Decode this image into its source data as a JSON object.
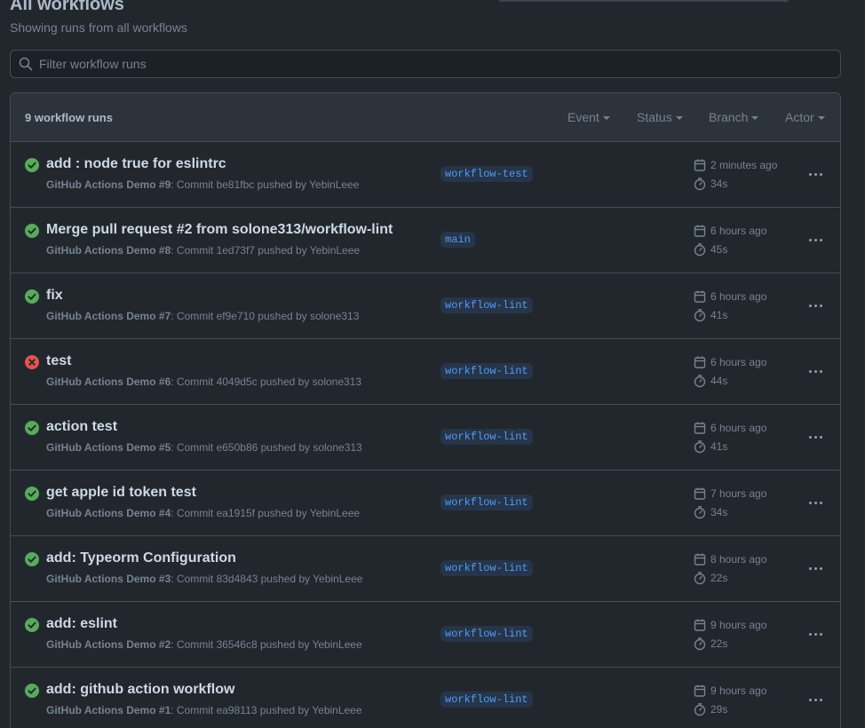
{
  "header": {
    "title": "All workflows",
    "subtitle": "Showing runs from all workflows"
  },
  "search": {
    "placeholder": "Filter workflow runs",
    "value": ""
  },
  "runs_header": {
    "count_label": "9 workflow runs",
    "filters": [
      "Event",
      "Status",
      "Branch",
      "Actor"
    ]
  },
  "colors": {
    "success": "#57ab5a",
    "failure": "#e5534b",
    "branch_text": "#539bf5"
  },
  "runs": [
    {
      "status": "success",
      "title": "add : node true for eslintrc",
      "workflow": "GitHub Actions Demo #9",
      "detail": ": Commit be81fbc pushed by YebinLeee",
      "branch": "workflow-test",
      "time": "2 minutes ago",
      "duration": "34s"
    },
    {
      "status": "success",
      "title": "Merge pull request #2 from solone313/workflow-lint",
      "workflow": "GitHub Actions Demo #8",
      "detail": ": Commit 1ed73f7 pushed by YebinLeee",
      "branch": "main",
      "time": "6 hours ago",
      "duration": "45s"
    },
    {
      "status": "success",
      "title": "fix",
      "workflow": "GitHub Actions Demo #7",
      "detail": ": Commit ef9e710 pushed by solone313",
      "branch": "workflow-lint",
      "time": "6 hours ago",
      "duration": "41s"
    },
    {
      "status": "failure",
      "title": "test",
      "workflow": "GitHub Actions Demo #6",
      "detail": ": Commit 4049d5c pushed by solone313",
      "branch": "workflow-lint",
      "time": "6 hours ago",
      "duration": "44s"
    },
    {
      "status": "success",
      "title": "action test",
      "workflow": "GitHub Actions Demo #5",
      "detail": ": Commit e650b86 pushed by solone313",
      "branch": "workflow-lint",
      "time": "6 hours ago",
      "duration": "41s"
    },
    {
      "status": "success",
      "title": "get apple id token test",
      "workflow": "GitHub Actions Demo #4",
      "detail": ": Commit ea1915f pushed by YebinLeee",
      "branch": "workflow-lint",
      "time": "7 hours ago",
      "duration": "34s"
    },
    {
      "status": "success",
      "title": "add: Typeorm Configuration",
      "workflow": "GitHub Actions Demo #3",
      "detail": ": Commit 83d4843 pushed by YebinLeee",
      "branch": "workflow-lint",
      "time": "8 hours ago",
      "duration": "22s"
    },
    {
      "status": "success",
      "title": "add: eslint",
      "workflow": "GitHub Actions Demo #2",
      "detail": ": Commit 36546c8 pushed by YebinLeee",
      "branch": "workflow-lint",
      "time": "9 hours ago",
      "duration": "22s"
    },
    {
      "status": "success",
      "title": "add: github action workflow",
      "workflow": "GitHub Actions Demo #1",
      "detail": ": Commit ea98113 pushed by YebinLeee",
      "branch": "workflow-lint",
      "time": "9 hours ago",
      "duration": "29s"
    }
  ]
}
